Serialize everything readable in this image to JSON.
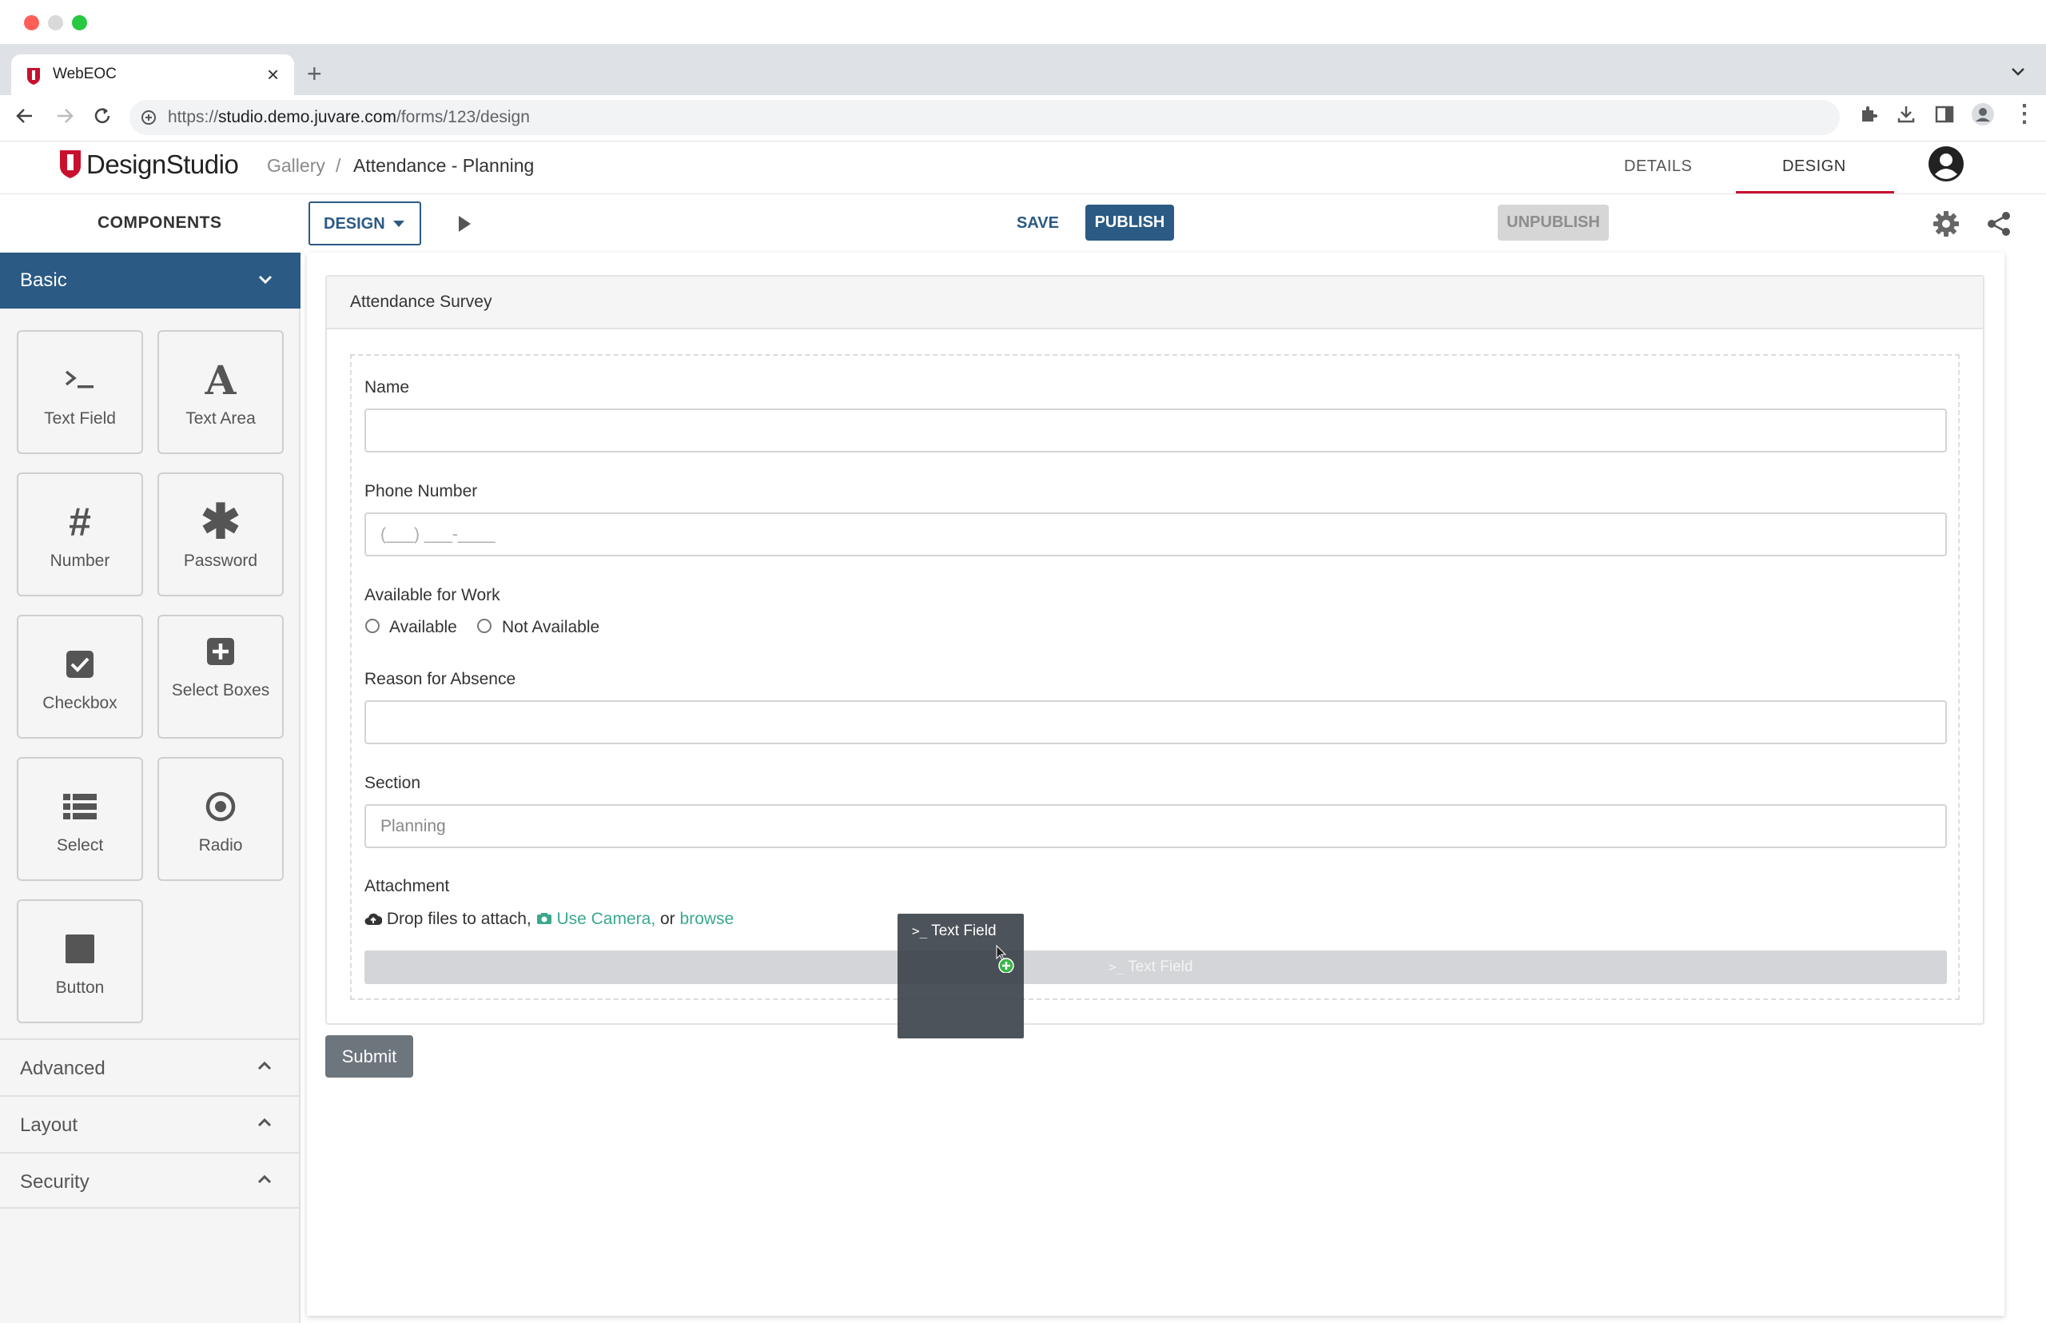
{
  "browser": {
    "tab_title": "WebEOC",
    "url_prefix": "https://",
    "url_host": "studio.demo.juvare.com",
    "url_path": "/forms/123/design"
  },
  "app": {
    "brand": "DesignStudio",
    "breadcrumb_gallery": "Gallery",
    "breadcrumb_separator": "/",
    "breadcrumb_current": "Attendance - Planning",
    "nav_details": "DETAILS",
    "nav_design": "DESIGN",
    "accent_color": "#c8102e",
    "primary_color": "#2b5a84"
  },
  "toolbar": {
    "components_label": "COMPONENTS",
    "mode_label": "DESIGN",
    "save_label": "SAVE",
    "publish_label": "PUBLISH",
    "unpublish_label": "UNPUBLISH"
  },
  "sidebar": {
    "basic_label": "Basic",
    "components": [
      {
        "label": "Text Field",
        "icon": "terminal-icon"
      },
      {
        "label": "Text Area",
        "icon": "font-icon"
      },
      {
        "label": "Number",
        "icon": "hashtag-icon"
      },
      {
        "label": "Password",
        "icon": "asterisk-icon"
      },
      {
        "label": "Checkbox",
        "icon": "check-square-icon"
      },
      {
        "label": "Select Boxes",
        "icon": "plus-square-icon"
      },
      {
        "label": "Select",
        "icon": "list-icon"
      },
      {
        "label": "Radio",
        "icon": "dot-circle-icon"
      },
      {
        "label": "Button",
        "icon": "stop-icon"
      }
    ],
    "advanced_label": "Advanced",
    "layout_label": "Layout",
    "security_label": "Security"
  },
  "form": {
    "title": "Attendance Survey",
    "name_label": "Name",
    "phone_label": "Phone Number",
    "phone_placeholder": "(___) ___-____",
    "availability_label": "Available for Work",
    "option_available": "Available",
    "option_not_available": "Not Available",
    "reason_label": "Reason for Absence",
    "section_label": "Section",
    "section_placeholder": "Planning",
    "attachment_label": "Attachment",
    "drop_text": "Drop files to attach,",
    "use_camera": "Use Camera,",
    "or_text": "or",
    "browse": "browse",
    "placeholder_component": "Text Field",
    "submit_label": "Submit"
  },
  "drag_ghost": {
    "label": "Text Field"
  }
}
